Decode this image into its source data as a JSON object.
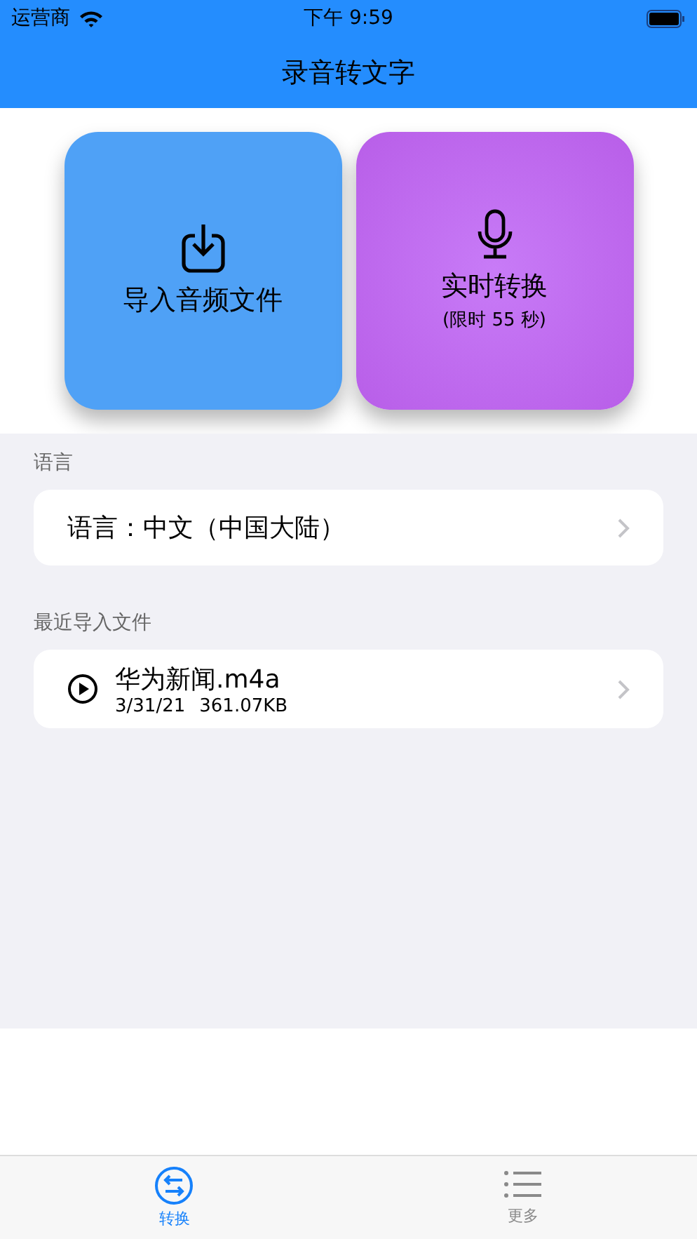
{
  "status_bar": {
    "carrier": "运营商",
    "time": "下午 9:59"
  },
  "nav": {
    "title": "录音转文字"
  },
  "actions": [
    {
      "kind": "import",
      "label": "导入音频文件"
    },
    {
      "kind": "record",
      "label": "实时转换",
      "note": "(限时 55 秒)"
    }
  ],
  "language": {
    "header": "语言",
    "value": "语言：中文（中国大陆）"
  },
  "recent": {
    "header": "最近导入文件",
    "files": [
      {
        "name": "华为新闻.m4a",
        "date": "3/31/21",
        "size": "361.07KB"
      }
    ]
  },
  "tabs": [
    {
      "kind": "convert",
      "label": "转换",
      "selected": true
    },
    {
      "kind": "more",
      "label": "更多",
      "selected": false
    }
  ]
}
